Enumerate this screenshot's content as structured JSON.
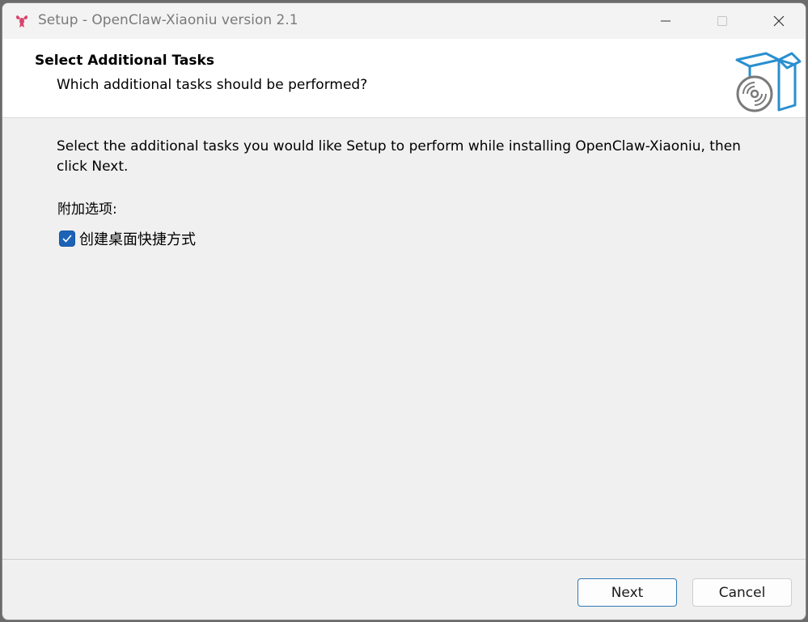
{
  "window": {
    "title": "Setup - OpenClaw-Xiaoniu version 2.1"
  },
  "header": {
    "title": "Select Additional Tasks",
    "subtitle": "Which additional tasks should be performed?"
  },
  "body": {
    "description": "Select the additional tasks you would like Setup to perform while installing OpenClaw-Xiaoniu, then click Next.",
    "group_label": "附加选项:",
    "tasks": [
      {
        "label": "创建桌面快捷方式",
        "checked": true
      }
    ]
  },
  "buttons": {
    "next": "Next",
    "cancel": "Cancel"
  },
  "colors": {
    "accent": "#1c63b8",
    "box_icon": "#2a8fcf",
    "app_icon": "#d9466f"
  }
}
